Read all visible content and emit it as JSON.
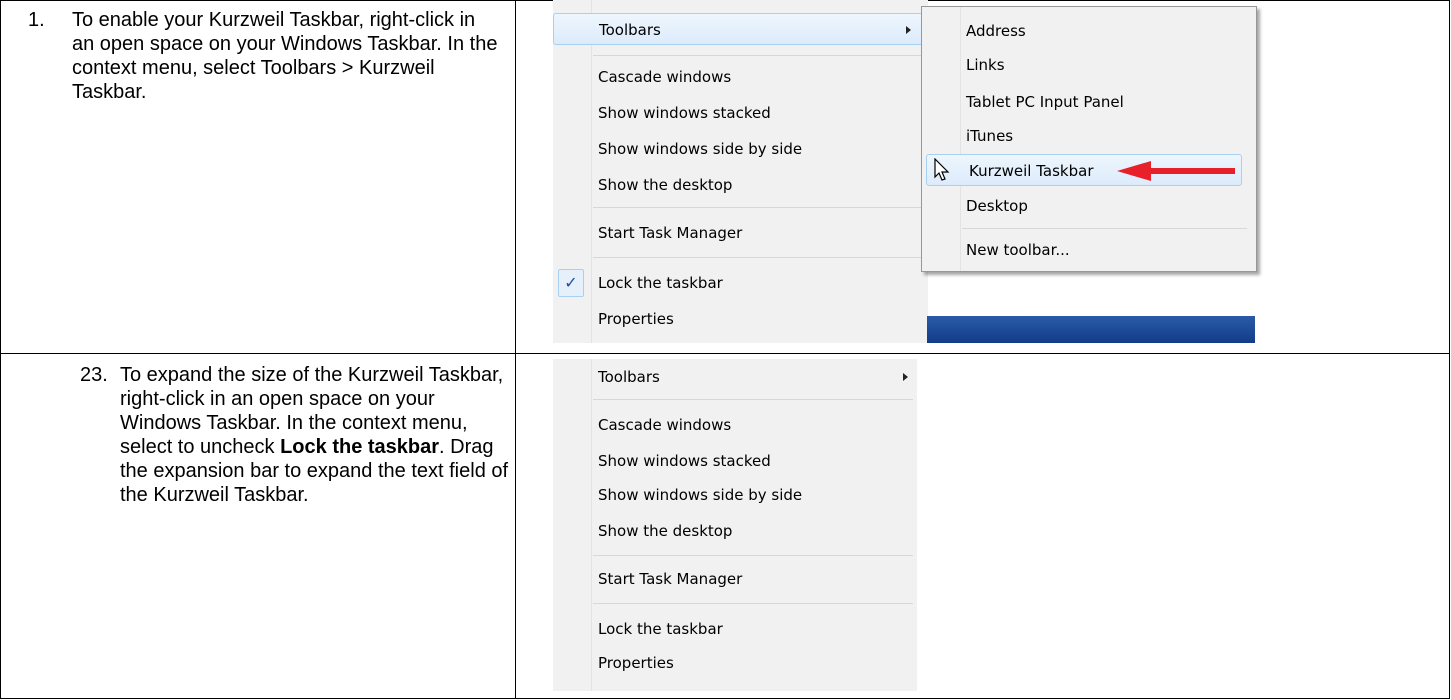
{
  "steps": [
    {
      "number": "1.",
      "text": "To enable your Kurzweil Taskbar, right-click in an open space on your Windows Taskbar. In the context menu, select Toolbars > Kurzweil Taskbar."
    },
    {
      "number": "23.",
      "text_before": "To expand the size of the Kurzweil Taskbar, right-click in an open space on your Windows Taskbar. In the context menu, select to uncheck ",
      "bold": "Lock the taskbar",
      "text_after": ". Drag the expansion bar to expand the text field of the Kurzweil Taskbar."
    }
  ],
  "menu1": {
    "items": [
      "Toolbars",
      "Cascade windows",
      "Show windows stacked",
      "Show windows side by side",
      "Show the desktop",
      "Start Task Manager",
      "Lock the taskbar",
      "Properties"
    ],
    "checked": "Lock the taskbar",
    "check_glyph": "✓"
  },
  "submenu": {
    "items": [
      "Address",
      "Links",
      "Tablet PC Input Panel",
      "iTunes",
      "Kurzweil Taskbar",
      "Desktop",
      "New toolbar..."
    ],
    "highlighted": "Kurzweil Taskbar"
  },
  "menu2": {
    "items": [
      "Toolbars",
      "Cascade windows",
      "Show windows stacked",
      "Show windows side by side",
      "Show the desktop",
      "Start Task Manager",
      "Lock the taskbar",
      "Properties"
    ]
  },
  "colors": {
    "highlight_border": "#a8d0f0",
    "arrow": "#e8202a",
    "taskbar": "#1f4f9f"
  }
}
